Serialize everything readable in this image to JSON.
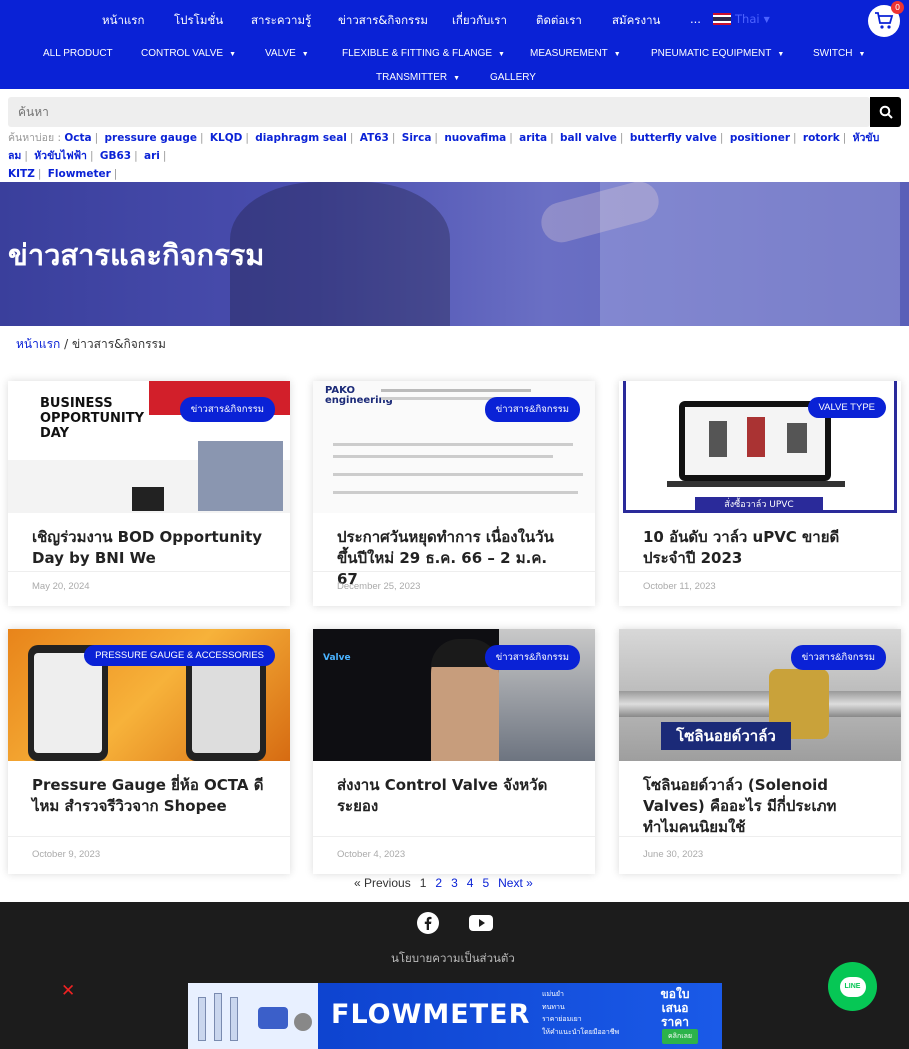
{
  "topnav": {
    "items": [
      "หน้าแรก",
      "โปรโมชั่น",
      "สาระความรู้",
      "ข่าวสาร&กิจกรรม",
      "เกี่ยวกับเรา",
      "ติดต่อเรา",
      "สมัครงาน",
      "..."
    ],
    "language": "Thai",
    "cart_count": "0"
  },
  "product_menu": {
    "items": [
      "ALL PRODUCT",
      "CONTROL VALVE",
      "VALVE",
      "FLEXIBLE & FITTING & FLANGE",
      "MEASUREMENT",
      "PNEUMATIC EQUIPMENT",
      "SWITCH",
      "TRANSMITTER",
      "GALLERY"
    ]
  },
  "search": {
    "placeholder": "ค้นหา"
  },
  "popular_tags": {
    "label": "ค้นหาบ่อย :",
    "tags": [
      "Octa",
      "pressure gauge",
      "KLQD",
      "diaphragm seal",
      "AT63",
      "Sirca",
      "nuovafima",
      "arita",
      "ball valve",
      "butterfly valve",
      "positioner",
      "rotork",
      "หัวขับลม",
      "หัวขับไฟฟ้า",
      "GB63",
      "ari",
      "KITZ",
      "Flowmeter"
    ]
  },
  "hero": {
    "title": "ข่าวสารและกิจกรรม"
  },
  "breadcrumb": {
    "home": "หน้าแรก",
    "current": "/ ข่าวสาร&กิจกรรม"
  },
  "posts": [
    {
      "badge": "ข่าวสาร&กิจกรรม",
      "title": "เชิญร่วมงาน BOD Opportunity Day by BNI We",
      "date": "May 20, 2024",
      "thumb_text": "BUSINESS OPPORTUNITY DAY"
    },
    {
      "badge": "ข่าวสาร&กิจกรรม",
      "title": "ประกาศวันหยุดทำการ เนื่องในวันขึ้นปีใหม่ 29 ธ.ค. 66 – 2 ม.ค. 67",
      "date": "December 25, 2023",
      "thumb_text": "PAKO engineering"
    },
    {
      "badge": "VALVE TYPE",
      "title": "10 อันดับ วาล์ว uPVC ขายดี ประจำปี 2023",
      "date": "October 11, 2023",
      "thumb_text": "สั่งซื้อวาล์ว UPVC"
    },
    {
      "badge": "PRESSURE GAUGE & ACCESSORIES",
      "title": "Pressure Gauge ยี่ห้อ OCTA ดีไหม สำรวจรีวิวจาก Shopee",
      "date": "October 9, 2023",
      "thumb_text": ""
    },
    {
      "badge": "ข่าวสาร&กิจกรรม",
      "title": "ส่งงาน Control Valve จังหวัดระยอง",
      "date": "October 4, 2023",
      "thumb_text": "Valve"
    },
    {
      "badge": "ข่าวสาร&กิจกรรม",
      "title": "โซลินอยด์วาล์ว (Solenoid Valves) คืออะไร มีกี่ประเภท ทำไมคนนิยมใช้",
      "date": "June 30, 2023",
      "thumb_text": "โซลินอยด์วาล์ว"
    }
  ],
  "pagination": {
    "prev": "« Previous",
    "pages": [
      "1",
      "2",
      "3",
      "4",
      "5"
    ],
    "next": "Next »"
  },
  "footer": {
    "privacy": "นโยบายความเป็นส่วนตัว"
  },
  "banner": {
    "title": "FLOWMETER",
    "bullets": [
      "แม่นยำ",
      "ทนทาน",
      "ราคาย่อมเยา",
      "ให้คำแนะนำโดยมืออาชีพ"
    ],
    "cta": "ขอใบ เสนอ ราคา",
    "button": "คลิกเลย"
  },
  "colors": {
    "brand_blue": "#0a22d6",
    "line_green": "#06c755"
  }
}
